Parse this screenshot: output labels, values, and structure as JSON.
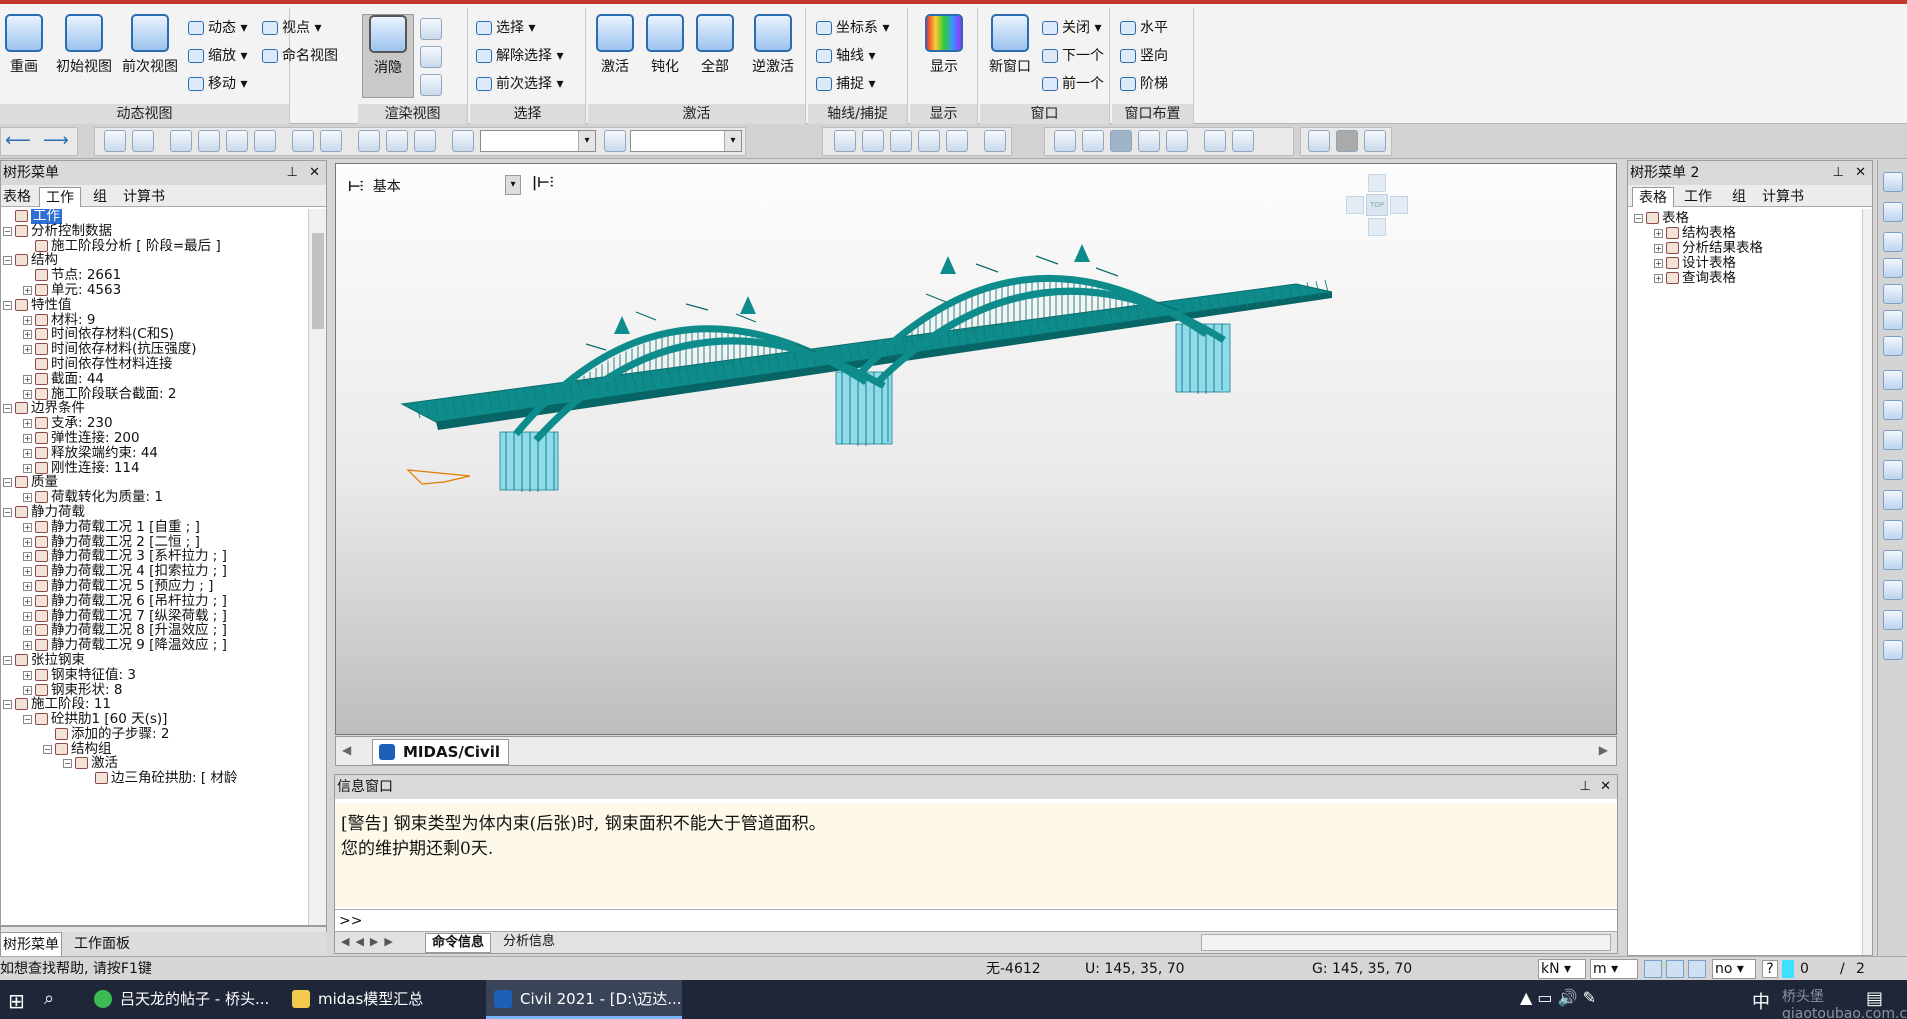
{
  "ribbon": {
    "view": {
      "redraw": "重画",
      "initial_view": "初始视图",
      "previous_view": "前次视图",
      "dynamic": "动态",
      "zoom": "缩放",
      "move": "移动",
      "view_point": "视点",
      "named_view": "命名视图",
      "title": "动态视图"
    },
    "render": {
      "hidden": "消隐",
      "title": "渲染视图"
    },
    "select": {
      "select": "选择",
      "deselect": "解除选择",
      "previous_select": "前次选择",
      "title": "选择"
    },
    "activate": {
      "activate": "激活",
      "deactivate": "钝化",
      "all": "全部",
      "inverse": "逆激活",
      "title": "激活"
    },
    "grid": {
      "ucs": "坐标系",
      "grid": "轴线",
      "snap": "捕捉",
      "title": "轴线/捕捉"
    },
    "display": {
      "display": "显示",
      "title": "显示"
    },
    "window": {
      "new_window": "新窗口",
      "close": "关闭",
      "next": "下一个",
      "previous": "前一个",
      "title": "窗口"
    },
    "layout": {
      "horizontal": "水平",
      "vertical": "竖向",
      "cascade": "阶梯",
      "title": "窗口布置"
    }
  },
  "left_panel": {
    "title": "树形菜单",
    "tabs": [
      "表格",
      "工作",
      "组",
      "计算书"
    ],
    "items": [
      {
        "indent": 0,
        "exp": "",
        "text": "工作",
        "selected": true
      },
      {
        "indent": 0,
        "exp": "−",
        "text": "分析控制数据"
      },
      {
        "indent": 1,
        "exp": "",
        "text": "施工阶段分析 [ 阶段=最后 ]"
      },
      {
        "indent": 0,
        "exp": "−",
        "text": "结构"
      },
      {
        "indent": 1,
        "exp": "",
        "text": "节点: 2661"
      },
      {
        "indent": 1,
        "exp": "+",
        "text": "单元: 4563"
      },
      {
        "indent": 0,
        "exp": "−",
        "text": "特性值"
      },
      {
        "indent": 1,
        "exp": "+",
        "text": "材料: 9"
      },
      {
        "indent": 1,
        "exp": "+",
        "text": "时间依存材料(C和S)"
      },
      {
        "indent": 1,
        "exp": "+",
        "text": "时间依存材料(抗压强度)"
      },
      {
        "indent": 1,
        "exp": "",
        "text": "时间依存性材料连接"
      },
      {
        "indent": 1,
        "exp": "+",
        "text": "截面: 44"
      },
      {
        "indent": 1,
        "exp": "+",
        "text": "施工阶段联合截面: 2"
      },
      {
        "indent": 0,
        "exp": "−",
        "text": "边界条件"
      },
      {
        "indent": 1,
        "exp": "+",
        "text": "支承: 230"
      },
      {
        "indent": 1,
        "exp": "+",
        "text": "弹性连接: 200"
      },
      {
        "indent": 1,
        "exp": "+",
        "text": "释放梁端约束: 44"
      },
      {
        "indent": 1,
        "exp": "+",
        "text": "刚性连接: 114"
      },
      {
        "indent": 0,
        "exp": "−",
        "text": "质量"
      },
      {
        "indent": 1,
        "exp": "+",
        "text": "荷载转化为质量: 1"
      },
      {
        "indent": 0,
        "exp": "−",
        "text": "静力荷载"
      },
      {
        "indent": 1,
        "exp": "+",
        "text": "静力荷载工况 1 [自重 ; ]"
      },
      {
        "indent": 1,
        "exp": "+",
        "text": "静力荷载工况 2 [二恒 ; ]"
      },
      {
        "indent": 1,
        "exp": "+",
        "text": "静力荷载工况 3 [系杆拉力 ; ]"
      },
      {
        "indent": 1,
        "exp": "+",
        "text": "静力荷载工况 4 [扣索拉力 ; ]"
      },
      {
        "indent": 1,
        "exp": "+",
        "text": "静力荷载工况 5 [预应力 ; ]"
      },
      {
        "indent": 1,
        "exp": "+",
        "text": "静力荷载工况 6 [吊杆拉力 ; ]"
      },
      {
        "indent": 1,
        "exp": "+",
        "text": "静力荷载工况 7 [纵梁荷载 ; ]"
      },
      {
        "indent": 1,
        "exp": "+",
        "text": "静力荷载工况 8 [升温效应 ; ]"
      },
      {
        "indent": 1,
        "exp": "+",
        "text": "静力荷载工况 9 [降温效应 ; ]"
      },
      {
        "indent": 0,
        "exp": "−",
        "text": "张拉钢束"
      },
      {
        "indent": 1,
        "exp": "+",
        "text": "钢束特征值: 3"
      },
      {
        "indent": 1,
        "exp": "+",
        "text": "钢束形状: 8"
      },
      {
        "indent": 0,
        "exp": "−",
        "text": "施工阶段: 11"
      },
      {
        "indent": 1,
        "exp": "−",
        "text": "砼拱肋1 [60 天(s)]"
      },
      {
        "indent": 2,
        "exp": "",
        "text": "添加的子步骤: 2"
      },
      {
        "indent": 2,
        "exp": "−",
        "text": "结构组"
      },
      {
        "indent": 3,
        "exp": "−",
        "text": "激活"
      },
      {
        "indent": 4,
        "exp": "",
        "text": "边三角砼拱肋: [ 材龄"
      }
    ],
    "bottom_tabs": [
      "树形菜单",
      "工作面板"
    ]
  },
  "right_panel": {
    "title": "树形菜单 2",
    "tabs": [
      "表格",
      "工作",
      "组",
      "计算书"
    ],
    "items": [
      {
        "indent": 0,
        "exp": "−",
        "text": "表格"
      },
      {
        "indent": 1,
        "exp": "+",
        "text": "结构表格"
      },
      {
        "indent": 1,
        "exp": "+",
        "text": "分析结果表格"
      },
      {
        "indent": 1,
        "exp": "+",
        "text": "设计表格"
      },
      {
        "indent": 1,
        "exp": "+",
        "text": "查询表格"
      }
    ]
  },
  "viewport": {
    "view_label": "基本",
    "view_cube": "TOP",
    "tab_label": "MIDAS/Civil"
  },
  "message_window": {
    "title": "信息窗口",
    "lines": [
      "[警告] 钢束类型为体内束(后张)时, 钢束面积不能大于管道面积。",
      "您的维护期还剩0天."
    ],
    "prompt": ">>",
    "tabs": [
      "命令信息",
      "分析信息"
    ]
  },
  "statusbar": {
    "help": "如想查找帮助, 请按F1键",
    "node": "无-4612",
    "u_coord": "U: 145, 35, 70",
    "g_coord": "G: 145, 35, 70",
    "force_unit": "kN",
    "length_unit": "m",
    "filter": "no",
    "page_value": "0",
    "page_total": "2"
  },
  "taskbar": {
    "tasks": [
      "吕天龙的帖子 - 桥头...",
      "midas模型汇总",
      "Civil 2021 - [D:\\迈达..."
    ],
    "ime": "中",
    "watermark": "桥头堡 qiaotoubao.com.cn"
  },
  "colors": {
    "accent": "#c0392b",
    "bridge": "#0e8c8c",
    "bridge_light": "#7fd3e0",
    "select": "#2f6fd6",
    "taskbar": "#1e2638"
  }
}
